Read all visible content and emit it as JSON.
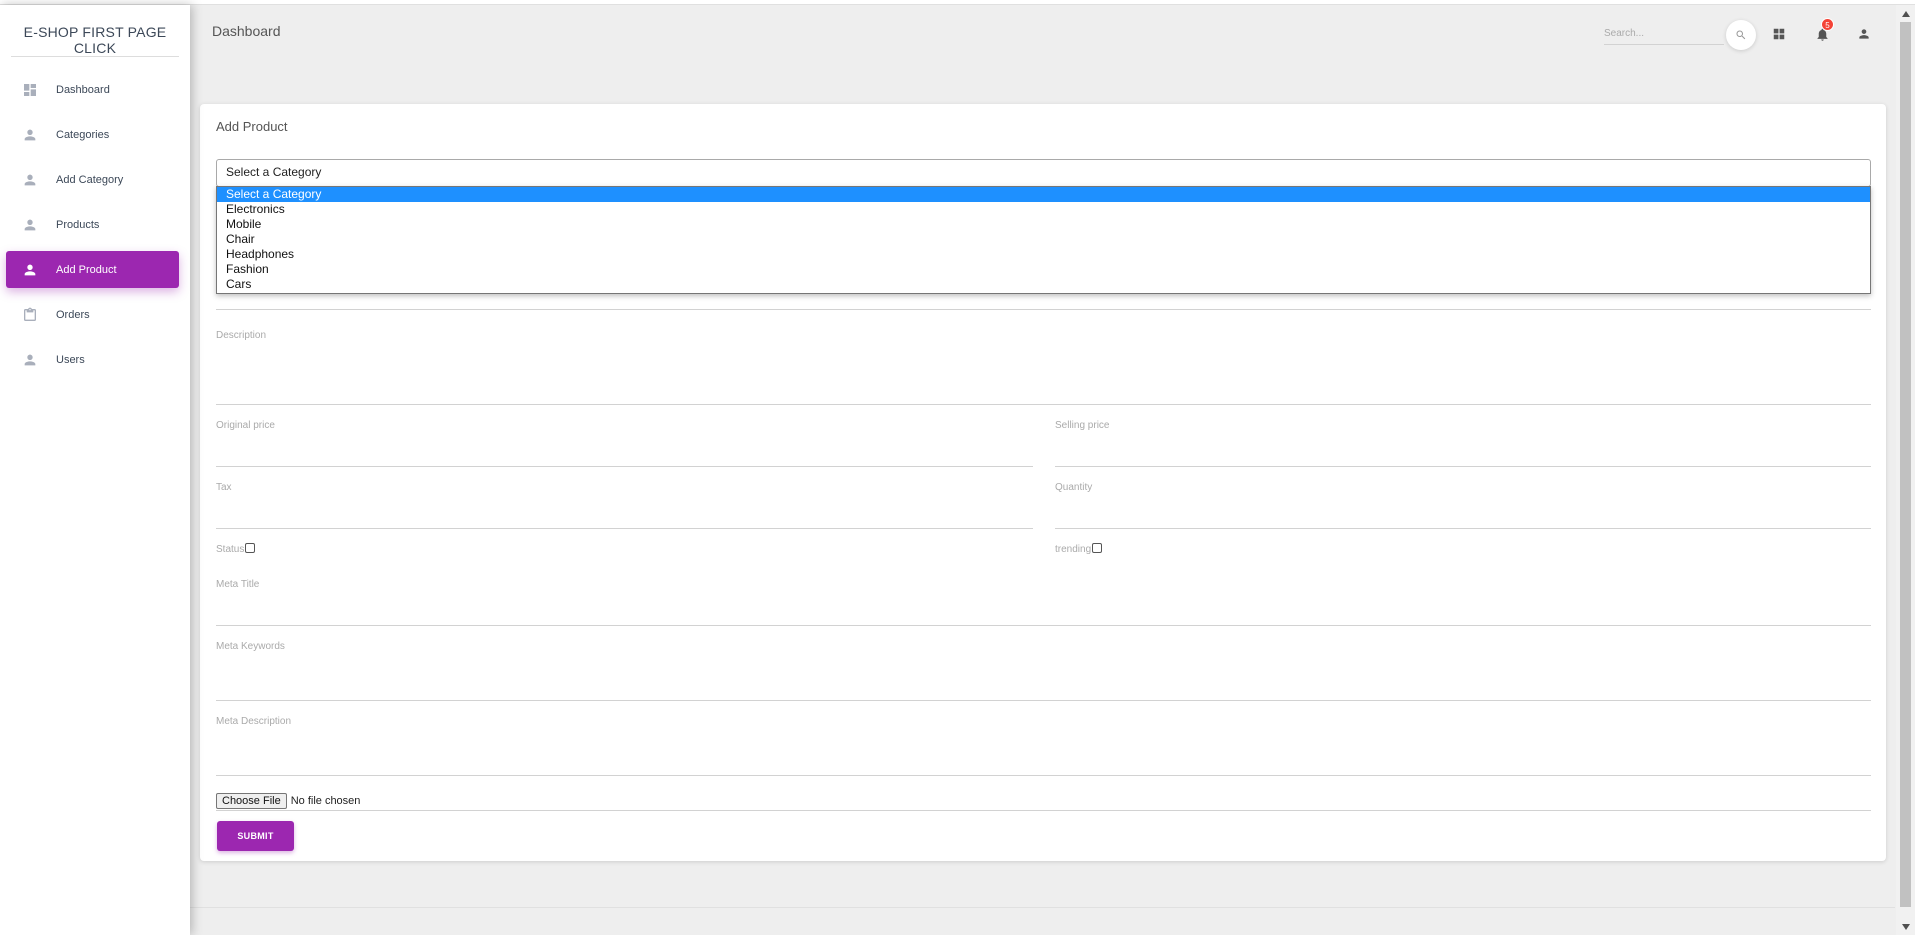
{
  "brand": "E-SHOP FIRST PAGE CLICK",
  "sidebar": {
    "items": [
      {
        "label": "Dashboard",
        "icon": "dashboard-icon"
      },
      {
        "label": "Categories",
        "icon": "person-icon"
      },
      {
        "label": "Add Category",
        "icon": "person-icon"
      },
      {
        "label": "Products",
        "icon": "person-icon"
      },
      {
        "label": "Add Product",
        "icon": "person-icon",
        "active": true
      },
      {
        "label": "Orders",
        "icon": "clipboard-icon"
      },
      {
        "label": "Users",
        "icon": "person-icon"
      }
    ]
  },
  "navbar": {
    "title": "Dashboard",
    "search_placeholder": "Search...",
    "notification_count": "5"
  },
  "form": {
    "title": "Add Product",
    "category_select": {
      "selected": "Select a Category",
      "options": [
        "Select a Category",
        "Electronics",
        "Mobile",
        "Chair",
        "Headphones",
        "Fashion",
        "Cars"
      ]
    },
    "labels": {
      "description": "Description",
      "original_price": "Original price",
      "selling_price": "Selling price",
      "tax": "Tax",
      "quantity": "Quantity",
      "status": "Status",
      "trending": "trending",
      "meta_title": "Meta Title",
      "meta_keywords": "Meta Keywords",
      "meta_description": "Meta Description"
    },
    "file": {
      "button": "Choose File",
      "status": "No file chosen"
    },
    "submit": "SUBMIT"
  },
  "colors": {
    "accent": "#9c27b0",
    "badge": "#f44336",
    "highlight": "#1e90ff"
  }
}
